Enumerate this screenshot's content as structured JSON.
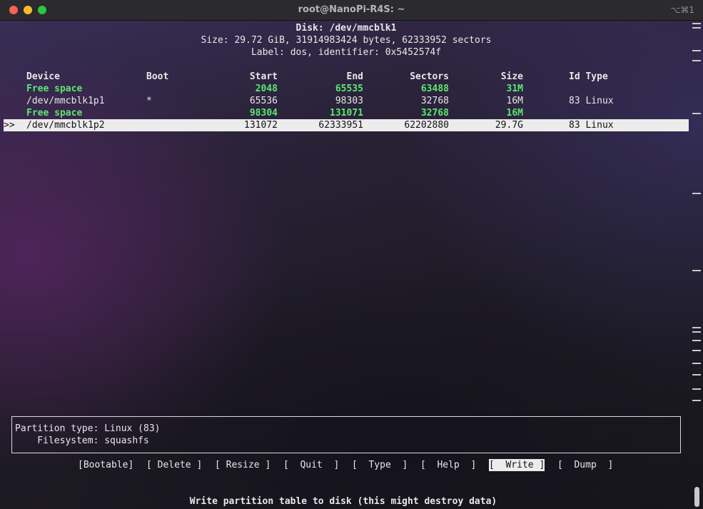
{
  "window": {
    "title": "root@NanoPi-R4S: ~",
    "shortcut": "⌥⌘1"
  },
  "disk": {
    "line1": "Disk: /dev/mmcblk1",
    "line2": "Size: 29.72 GiB, 31914983424 bytes, 62333952 sectors",
    "line3": "Label: dos, identifier: 0x5452574f"
  },
  "table": {
    "headers": {
      "device": "Device",
      "boot": "Boot",
      "start": "Start",
      "end": "End",
      "sectors": "Sectors",
      "size": "Size",
      "idtype": "Id Type"
    },
    "rows": [
      {
        "marker": "",
        "device": "Free space",
        "boot": "",
        "start": "2048",
        "end": "65535",
        "sectors": "63488",
        "size": "31M",
        "idtype": "",
        "free": true,
        "selected": false
      },
      {
        "marker": "",
        "device": "/dev/mmcblk1p1",
        "boot": "*",
        "start": "65536",
        "end": "98303",
        "sectors": "32768",
        "size": "16M",
        "idtype": "83 Linux",
        "free": false,
        "selected": false
      },
      {
        "marker": "",
        "device": "Free space",
        "boot": "",
        "start": "98304",
        "end": "131071",
        "sectors": "32768",
        "size": "16M",
        "idtype": "",
        "free": true,
        "selected": false
      },
      {
        "marker": ">>",
        "device": "/dev/mmcblk1p2",
        "boot": "",
        "start": "131072",
        "end": "62333951",
        "sectors": "62202880",
        "size": "29.7G",
        "idtype": "83 Linux",
        "free": false,
        "selected": true
      }
    ]
  },
  "info": {
    "line1": "Partition type: Linux (83)",
    "line2": "    Filesystem: squashfs"
  },
  "menu": [
    {
      "label": "[Bootable]",
      "active": false
    },
    {
      "label": "[ Delete ]",
      "active": false
    },
    {
      "label": "[ Resize ]",
      "active": false
    },
    {
      "label": "[  Quit  ]",
      "active": false
    },
    {
      "label": "[  Type  ]",
      "active": false
    },
    {
      "label": "[  Help  ]",
      "active": false
    },
    {
      "label": "[  Write ]",
      "active": true
    },
    {
      "label": "[  Dump  ]",
      "active": false
    }
  ],
  "status": "Write partition table to disk (this might destroy data)"
}
